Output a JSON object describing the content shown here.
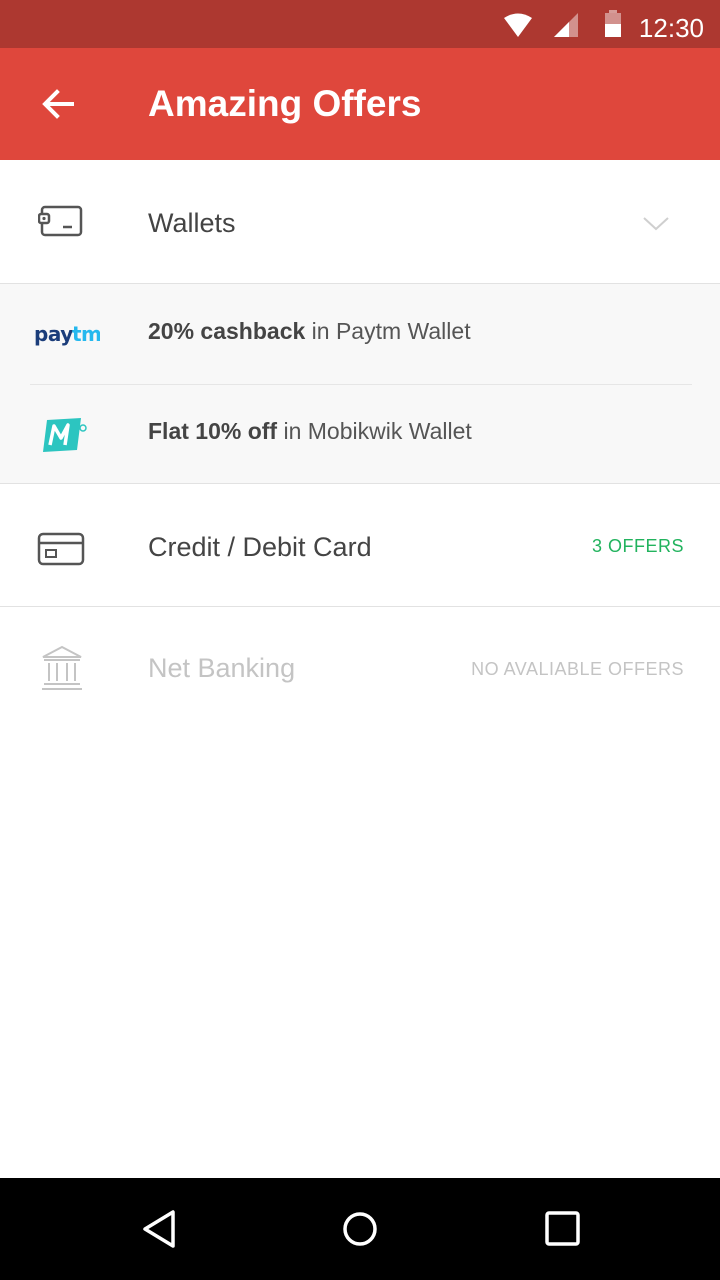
{
  "status_bar": {
    "time": "12:30",
    "icons": [
      "wifi-icon",
      "cell-signal-icon",
      "battery-icon"
    ]
  },
  "app_bar": {
    "back_icon": "arrow-back-icon",
    "title": "Amazing Offers"
  },
  "sections": {
    "wallets": {
      "label": "Wallets",
      "icon": "wallet-icon",
      "expanded": true,
      "offers": [
        {
          "brand": "paytm",
          "brand_logo_text": "paytm",
          "highlight": "20% cashback",
          "rest": " in Paytm Wallet"
        },
        {
          "brand": "mobikwik",
          "brand_logo_text": "M",
          "highlight": "Flat 10% off",
          "rest": " in Mobikwik Wallet"
        }
      ]
    },
    "card": {
      "label": "Credit / Debit Card",
      "icon": "credit-card-icon",
      "badge": "3 OFFERS"
    },
    "net_banking": {
      "label": "Net Banking",
      "icon": "bank-icon",
      "badge": "NO AVALIABLE OFFERS",
      "disabled": true
    }
  },
  "colors": {
    "status_bar": "#ad3830",
    "app_bar": "#df473c",
    "offer_green": "#22b35e",
    "disabled_text": "#c4c4c4",
    "paytm_dark": "#1b3d7a",
    "paytm_light": "#25b8ee",
    "mobikwik": "#2cc5c0"
  },
  "nav_bar": {
    "icons": [
      "back-triangle-icon",
      "home-circle-icon",
      "recents-square-icon"
    ]
  }
}
